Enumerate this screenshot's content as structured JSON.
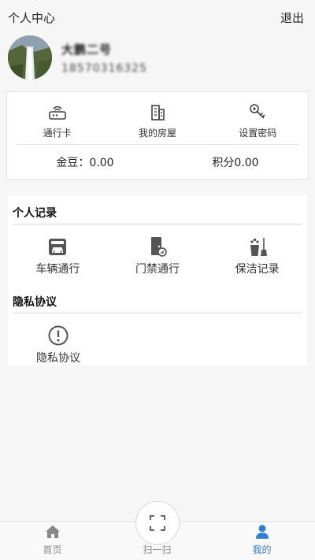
{
  "header": {
    "title": "个人中心",
    "logout": "退出"
  },
  "profile": {
    "name": "大鹏二号",
    "phone": "18570316325"
  },
  "quick_actions": [
    {
      "label": "通行卡",
      "icon": "router-card-icon"
    },
    {
      "label": "我的房屋",
      "icon": "building-icon"
    },
    {
      "label": "设置密码",
      "icon": "key-icon"
    }
  ],
  "stats": {
    "gold_label": "金豆：",
    "gold_value": "0.00",
    "points_label": "积分",
    "points_value": "0.00"
  },
  "personal_records": {
    "title": "个人记录",
    "items": [
      {
        "label": "车辆通行",
        "icon": "car-gate-icon"
      },
      {
        "label": "门禁通行",
        "icon": "door-access-icon"
      },
      {
        "label": "保洁记录",
        "icon": "cleaning-icon"
      }
    ]
  },
  "privacy": {
    "title": "隐私协议",
    "items": [
      {
        "label": "隐私协议",
        "icon": "alert-circle-icon"
      }
    ]
  },
  "tabbar": {
    "home": "首页",
    "scan": "扫一扫",
    "mine": "我的",
    "active": "mine",
    "active_color": "#2f7fd8"
  }
}
